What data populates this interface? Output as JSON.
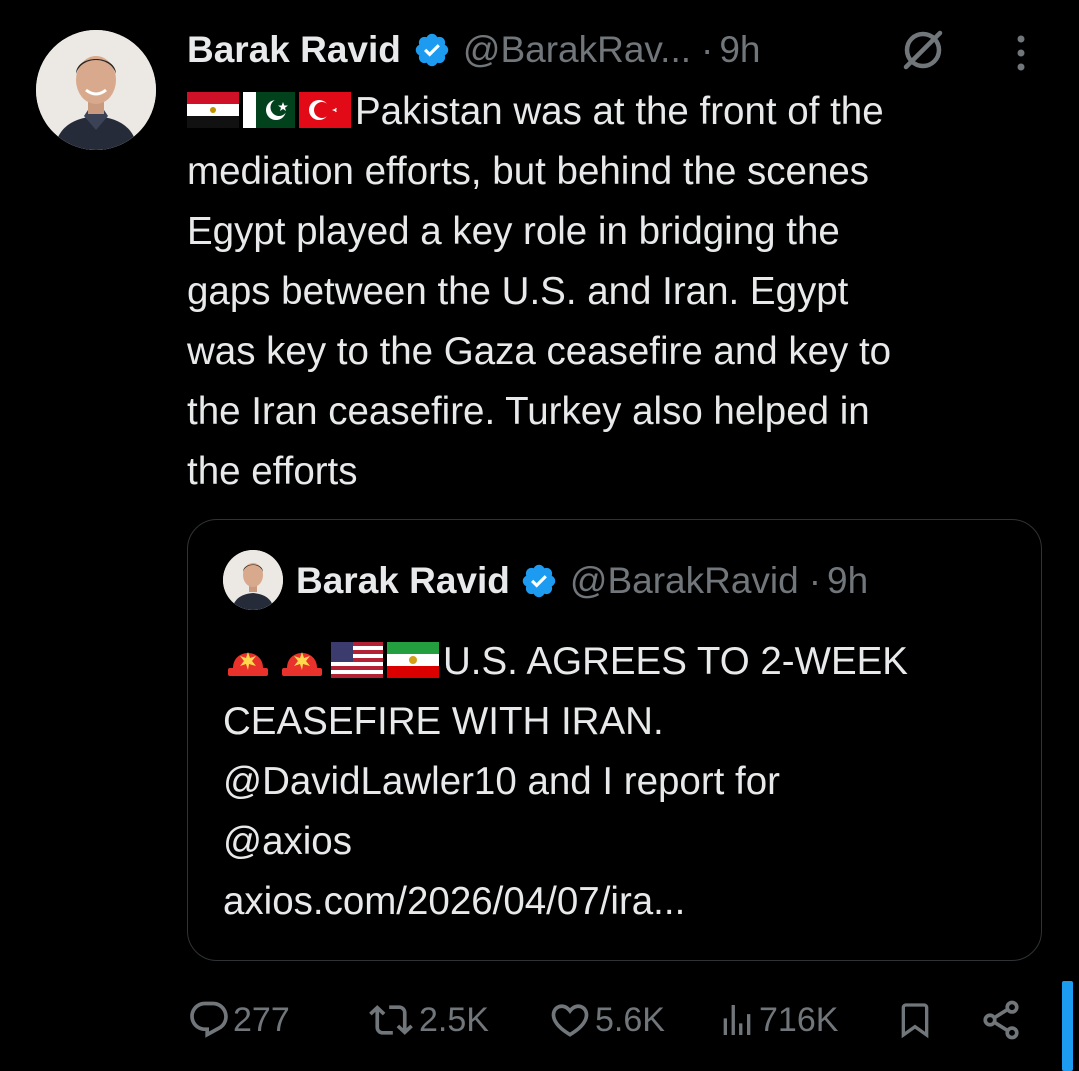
{
  "tweet": {
    "author_name": "Barak Ravid",
    "handle": "@BarakRav...",
    "separator": "·",
    "time": "9h",
    "flags": [
      "egypt-flag",
      "pakistan-flag",
      "turkey-flag"
    ],
    "lines": [
      "Pakistan was at the front of the",
      "mediation efforts, but behind the scenes",
      "Egypt played a key role in bridging the",
      "gaps between the U.S. and Iran. Egypt",
      "was key to the Gaza ceasefire and key to",
      "the Iran ceasefire. Turkey also helped in",
      "the efforts"
    ]
  },
  "quoted": {
    "author_name": "Barak Ravid",
    "handle": "@BarakRavid",
    "separator": "·",
    "time": "9h",
    "emojis": [
      "siren-emoji",
      "siren-emoji",
      "us-flag",
      "iran-flag"
    ],
    "lines": [
      "U.S. AGREES TO 2-WEEK",
      "CEASEFIRE WITH IRAN.",
      "@DavidLawler10 and I report for",
      "@axios",
      "axios.com/2026/04/07/ira..."
    ]
  },
  "actions": {
    "replies": "277",
    "reposts": "2.5K",
    "likes": "5.6K",
    "views": "716K"
  },
  "colors": {
    "background": "#000000",
    "text": "#e7e9ea",
    "secondary": "#71767b",
    "verified": "#1d9bf0",
    "border": "#2f3336"
  }
}
